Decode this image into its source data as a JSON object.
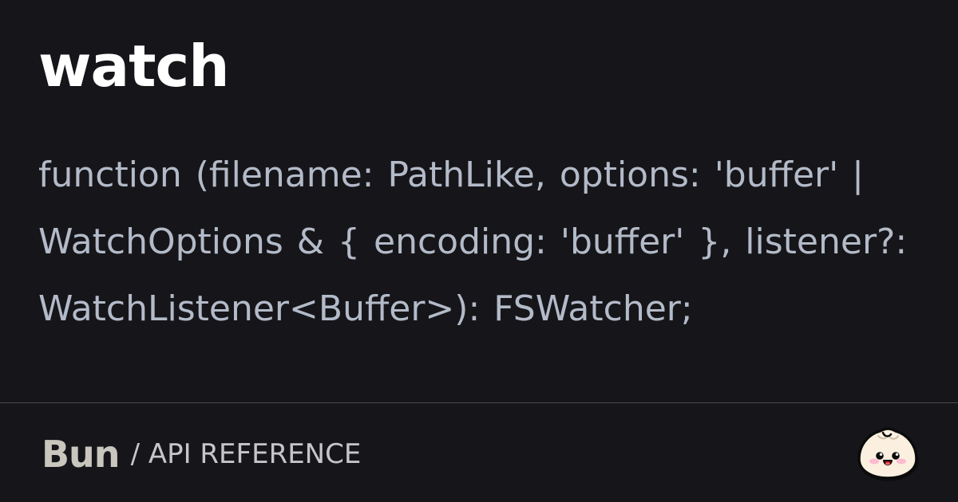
{
  "page": {
    "title": "watch",
    "signature": "function (filename: PathLike, options: 'buffer' | WatchOptions & { encoding: 'buffer' }, listener?: WatchListener<Buffer>): FSWatcher;"
  },
  "footer": {
    "brand": "Bun",
    "breadcrumb": "/ API REFERENCE",
    "logo_icon": "bun-mascot-icon"
  },
  "colors": {
    "background": "#16161a",
    "title": "#ffffff",
    "signature": "#b3bac8",
    "brand": "#c8c6bd",
    "divider": "#4a4a4f"
  }
}
